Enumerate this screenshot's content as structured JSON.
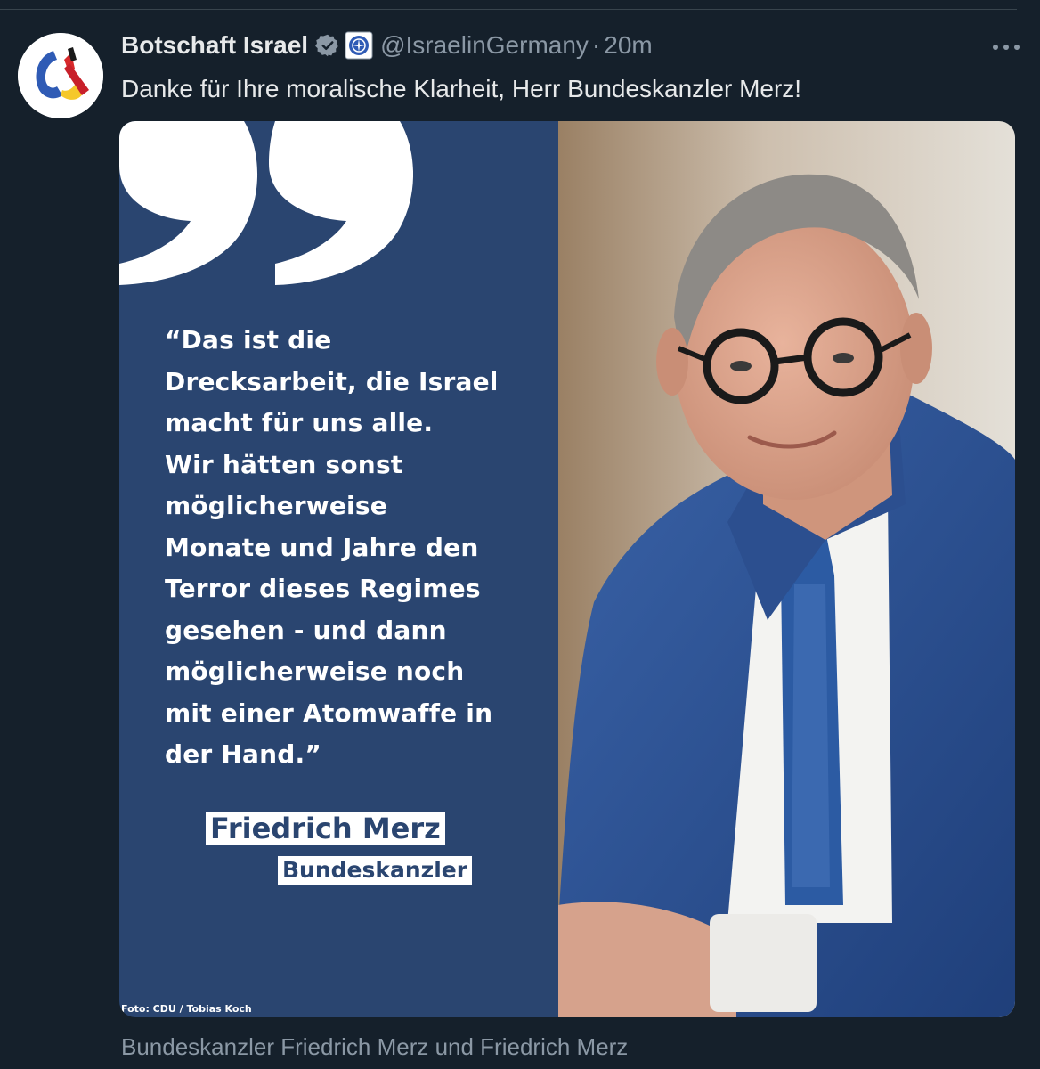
{
  "tweet": {
    "author": {
      "display_name": "Botschaft Israel",
      "handle": "@IsraelinGermany",
      "verified_icon": "verified-badge-icon",
      "affiliate_icon": "government-affiliate-icon",
      "avatar_icon": "embassy-logo-icon"
    },
    "separator": "·",
    "timestamp": "20m",
    "more_icon": "more-options-icon",
    "text": "Danke für Ihre moralische Klarheit, Herr Bundeskanzler Merz!",
    "media": {
      "quote_icon": "quotation-mark-icon",
      "quote": "“Das ist die\nDrecksarbeit, die Israel\nmacht für uns alle.\nWir hätten sonst\nmöglicherweise\nMonate und Jahre den\nTerror dieses Regimes\ngesehen - und dann\nmöglicherweise noch\nmit einer Atomwaffe in\nder Hand.”",
      "speaker_name": "Friedrich Merz",
      "speaker_title": "Bundeskanzler",
      "photo_credit": "Foto: CDU / Tobias Koch",
      "photo": "portrait-photo"
    },
    "media_caption": "Bundeskanzler Friedrich Merz und Friedrich Merz"
  },
  "colors": {
    "background": "#15202b",
    "text_primary": "#e7e9ea",
    "text_secondary": "#8b98a5",
    "quote_panel": "#2a4570",
    "verified": "#8b98a5"
  }
}
